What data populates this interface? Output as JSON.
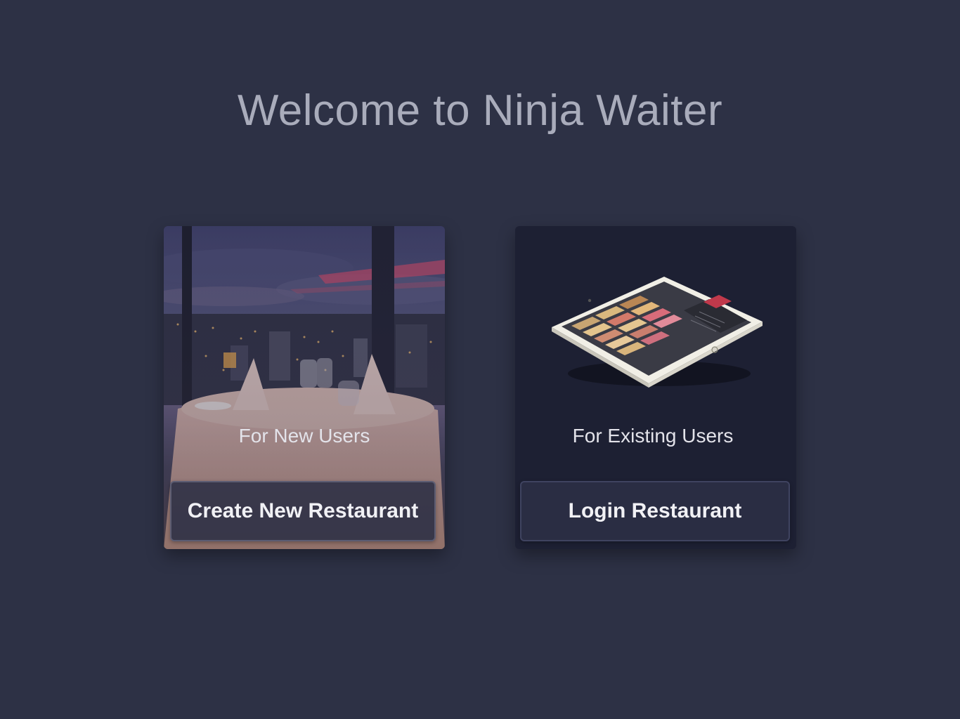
{
  "page": {
    "title": "Welcome to Ninja Waiter"
  },
  "cards": {
    "new_users": {
      "label": "For New Users",
      "button_label": "Create New Restaurant",
      "image": "restaurant-table-city-view"
    },
    "existing_users": {
      "label": "For Existing Users",
      "button_label": "Login Restaurant",
      "image": "tablet-menu-app"
    }
  },
  "colors": {
    "background": "#2d3145",
    "title_text": "#a9acbb",
    "existing_card_bg": "#1d2033",
    "button_bg": "#2a2d43",
    "button_text": "#f1f1f5",
    "tablet_accent": "#c0394b"
  }
}
